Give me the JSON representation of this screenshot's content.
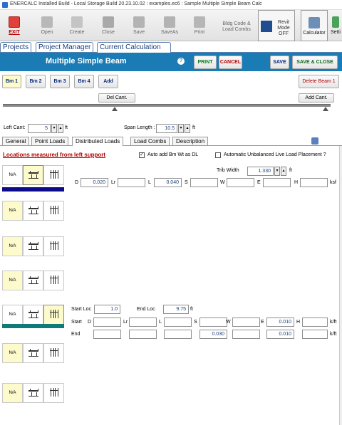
{
  "titlebar": {
    "text": "ENERCALC Installed Build - Local Storage Build 20.23.10.02 :   examples.ec6 : Sample Multiple Simple Beam Calc"
  },
  "toolbar": {
    "exit": "EXIT",
    "open": "Open",
    "create": "Create",
    "close": "Close",
    "save": "Save",
    "saveas": "SaveAs",
    "print": "Print",
    "bldg": "Bldg Code & Load Combs",
    "revit": "Revit Mode OFF",
    "calculator": "Calculator",
    "settings": "Setti"
  },
  "main_tabs": [
    "Projects",
    "Project Manager",
    "Current Calculation"
  ],
  "header": {
    "title": "Multiple Simple Beam",
    "help": "?",
    "print": "PRINT",
    "cancel": "CANCEL",
    "save": "SAVE",
    "save_close": "SAVE & CLOSE"
  },
  "beams": {
    "items": [
      "Bm 1",
      "Bm 2",
      "Bm 3",
      "Bm 4"
    ],
    "add": "Add",
    "delete": "Delete Beam 1"
  },
  "cantilever": {
    "del": "Del Cant.",
    "add": "Add Cant."
  },
  "geometry": {
    "left_cant_label": "Left Cant:",
    "left_cant_value": "5",
    "left_cant_unit": "ft",
    "span_label": "Span Length :",
    "span_value": "10.5",
    "span_unit": "ft"
  },
  "sub_tabs": [
    "General",
    "Point Loads",
    "Distributed Loads",
    "Load Combs",
    "Description"
  ],
  "dist": {
    "locations_label": "Locations measured from left support",
    "auto_add_label": "Auto add Bm Wt as DL",
    "auto_add_checked": "✓",
    "auto_unbal_label": "Automatic Unbalanced Live Load Placement ?",
    "trib_label": "Trib Width",
    "trib_value": "1.330",
    "trib_unit": "ft",
    "row1": {
      "d_label": "D",
      "d": "0.020",
      "lr_label": "Lr",
      "lr": "",
      "l_label": "L",
      "l": "0.040",
      "s_label": "S",
      "s": "",
      "w_label": "W",
      "w": "",
      "e_label": "E",
      "e": "",
      "h_label": "H",
      "h": "",
      "unit": "ksf"
    },
    "na": "N/A",
    "start_loc_label": "Start Loc",
    "start_loc": "1.0",
    "end_loc_label": "End Loc",
    "end_loc": "9.75",
    "loc_unit": "ft",
    "start_row": {
      "label": "Start",
      "d_label": "D",
      "d": "",
      "lr_label": "Lr",
      "lr": "",
      "l_label": "L",
      "l": "",
      "s_label": "S",
      "s": "",
      "w_label": "W",
      "w": "",
      "e_label": "E",
      "e": "0.010",
      "h_label": "H",
      "h": "",
      "unit": "k/ft"
    },
    "end_row": {
      "label": "End",
      "d": "",
      "lr": "",
      "l": "",
      "s": "0.030",
      "w": "",
      "e": "0.010",
      "h": "",
      "unit": "k/ft"
    }
  }
}
